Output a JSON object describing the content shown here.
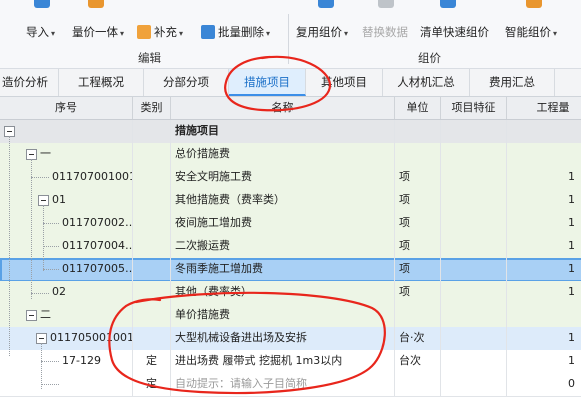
{
  "toolbar": {
    "buttons": [
      {
        "label": "导入",
        "dropdown": true
      },
      {
        "label": "量价一体",
        "dropdown": true
      },
      {
        "label": "补充",
        "dropdown": true,
        "icon": "add-supplement-icon"
      },
      {
        "label": "批量删除",
        "dropdown": true,
        "icon": "batch-delete-icon"
      },
      {
        "label": "复用组价",
        "dropdown": true
      },
      {
        "label": "替换数据",
        "disabled": true
      },
      {
        "label": "清单快速组价"
      },
      {
        "label": "智能组价",
        "dropdown": true
      }
    ],
    "groups": {
      "edit": "编辑",
      "price": "组价"
    }
  },
  "tabs": [
    {
      "label": "造价分析"
    },
    {
      "label": "工程概况"
    },
    {
      "label": "分部分项"
    },
    {
      "label": "措施项目",
      "active": true
    },
    {
      "label": "其他项目"
    },
    {
      "label": "人材机汇总"
    },
    {
      "label": "费用汇总"
    }
  ],
  "grid": {
    "columns": [
      "序号",
      "类别",
      "名称",
      "单位",
      "项目特征",
      "工程量"
    ],
    "rows": [
      {
        "seq": "",
        "type": "",
        "name": "措施项目",
        "unit": "",
        "feature": "",
        "qty": "",
        "style": "gray",
        "bold": true,
        "toggle": true,
        "level": 0
      },
      {
        "seq": "一",
        "type": "",
        "name": "总价措施费",
        "unit": "",
        "feature": "",
        "qty": "",
        "style": "green",
        "toggle": true,
        "level": 1
      },
      {
        "seq": "011707001001",
        "type": "",
        "name": "安全文明施工费",
        "unit": "项",
        "feature": "",
        "qty": "1",
        "style": "green",
        "level": 2
      },
      {
        "seq": "01",
        "type": "",
        "name": "其他措施费（费率类）",
        "unit": "项",
        "feature": "",
        "qty": "1",
        "style": "green",
        "toggle": true,
        "level": 2
      },
      {
        "seq": "011707002…",
        "type": "",
        "name": "夜间施工增加费",
        "unit": "项",
        "feature": "",
        "qty": "1",
        "style": "green",
        "level": 3
      },
      {
        "seq": "011707004…",
        "type": "",
        "name": "二次搬运费",
        "unit": "项",
        "feature": "",
        "qty": "1",
        "style": "green",
        "level": 3
      },
      {
        "seq": "011707005…",
        "type": "",
        "name": "冬雨季施工增加费",
        "unit": "项",
        "feature": "",
        "qty": "1",
        "style": "selected",
        "level": 3
      },
      {
        "seq": "02",
        "type": "",
        "name": "其他（费率类）",
        "unit": "项",
        "feature": "",
        "qty": "1",
        "style": "green",
        "level": 2
      },
      {
        "seq": "二",
        "type": "",
        "name": "单价措施费",
        "unit": "",
        "feature": "",
        "qty": "",
        "style": "green",
        "toggle": true,
        "level": 1
      },
      {
        "seq": "011705001001",
        "type": "",
        "name": "大型机械设备进出场及安拆",
        "unit": "台·次",
        "feature": "",
        "qty": "1",
        "style": "blue",
        "toggle": true,
        "level": 2
      },
      {
        "seq": "17-129",
        "type": "定",
        "name": "进出场费 履带式 挖掘机 1m3以内",
        "unit": "台次",
        "feature": "",
        "qty": "1",
        "style": "white",
        "level": 3
      },
      {
        "seq": "",
        "type": "定",
        "name": "自动提示：请输入子目简称",
        "unit": "",
        "feature": "",
        "qty": "0",
        "style": "white",
        "hint": true,
        "level": 3
      }
    ]
  },
  "colors": {
    "active_tab": "#1a6fc8",
    "annotation": "#e8261c",
    "selected_row": "#a9d0f5"
  }
}
